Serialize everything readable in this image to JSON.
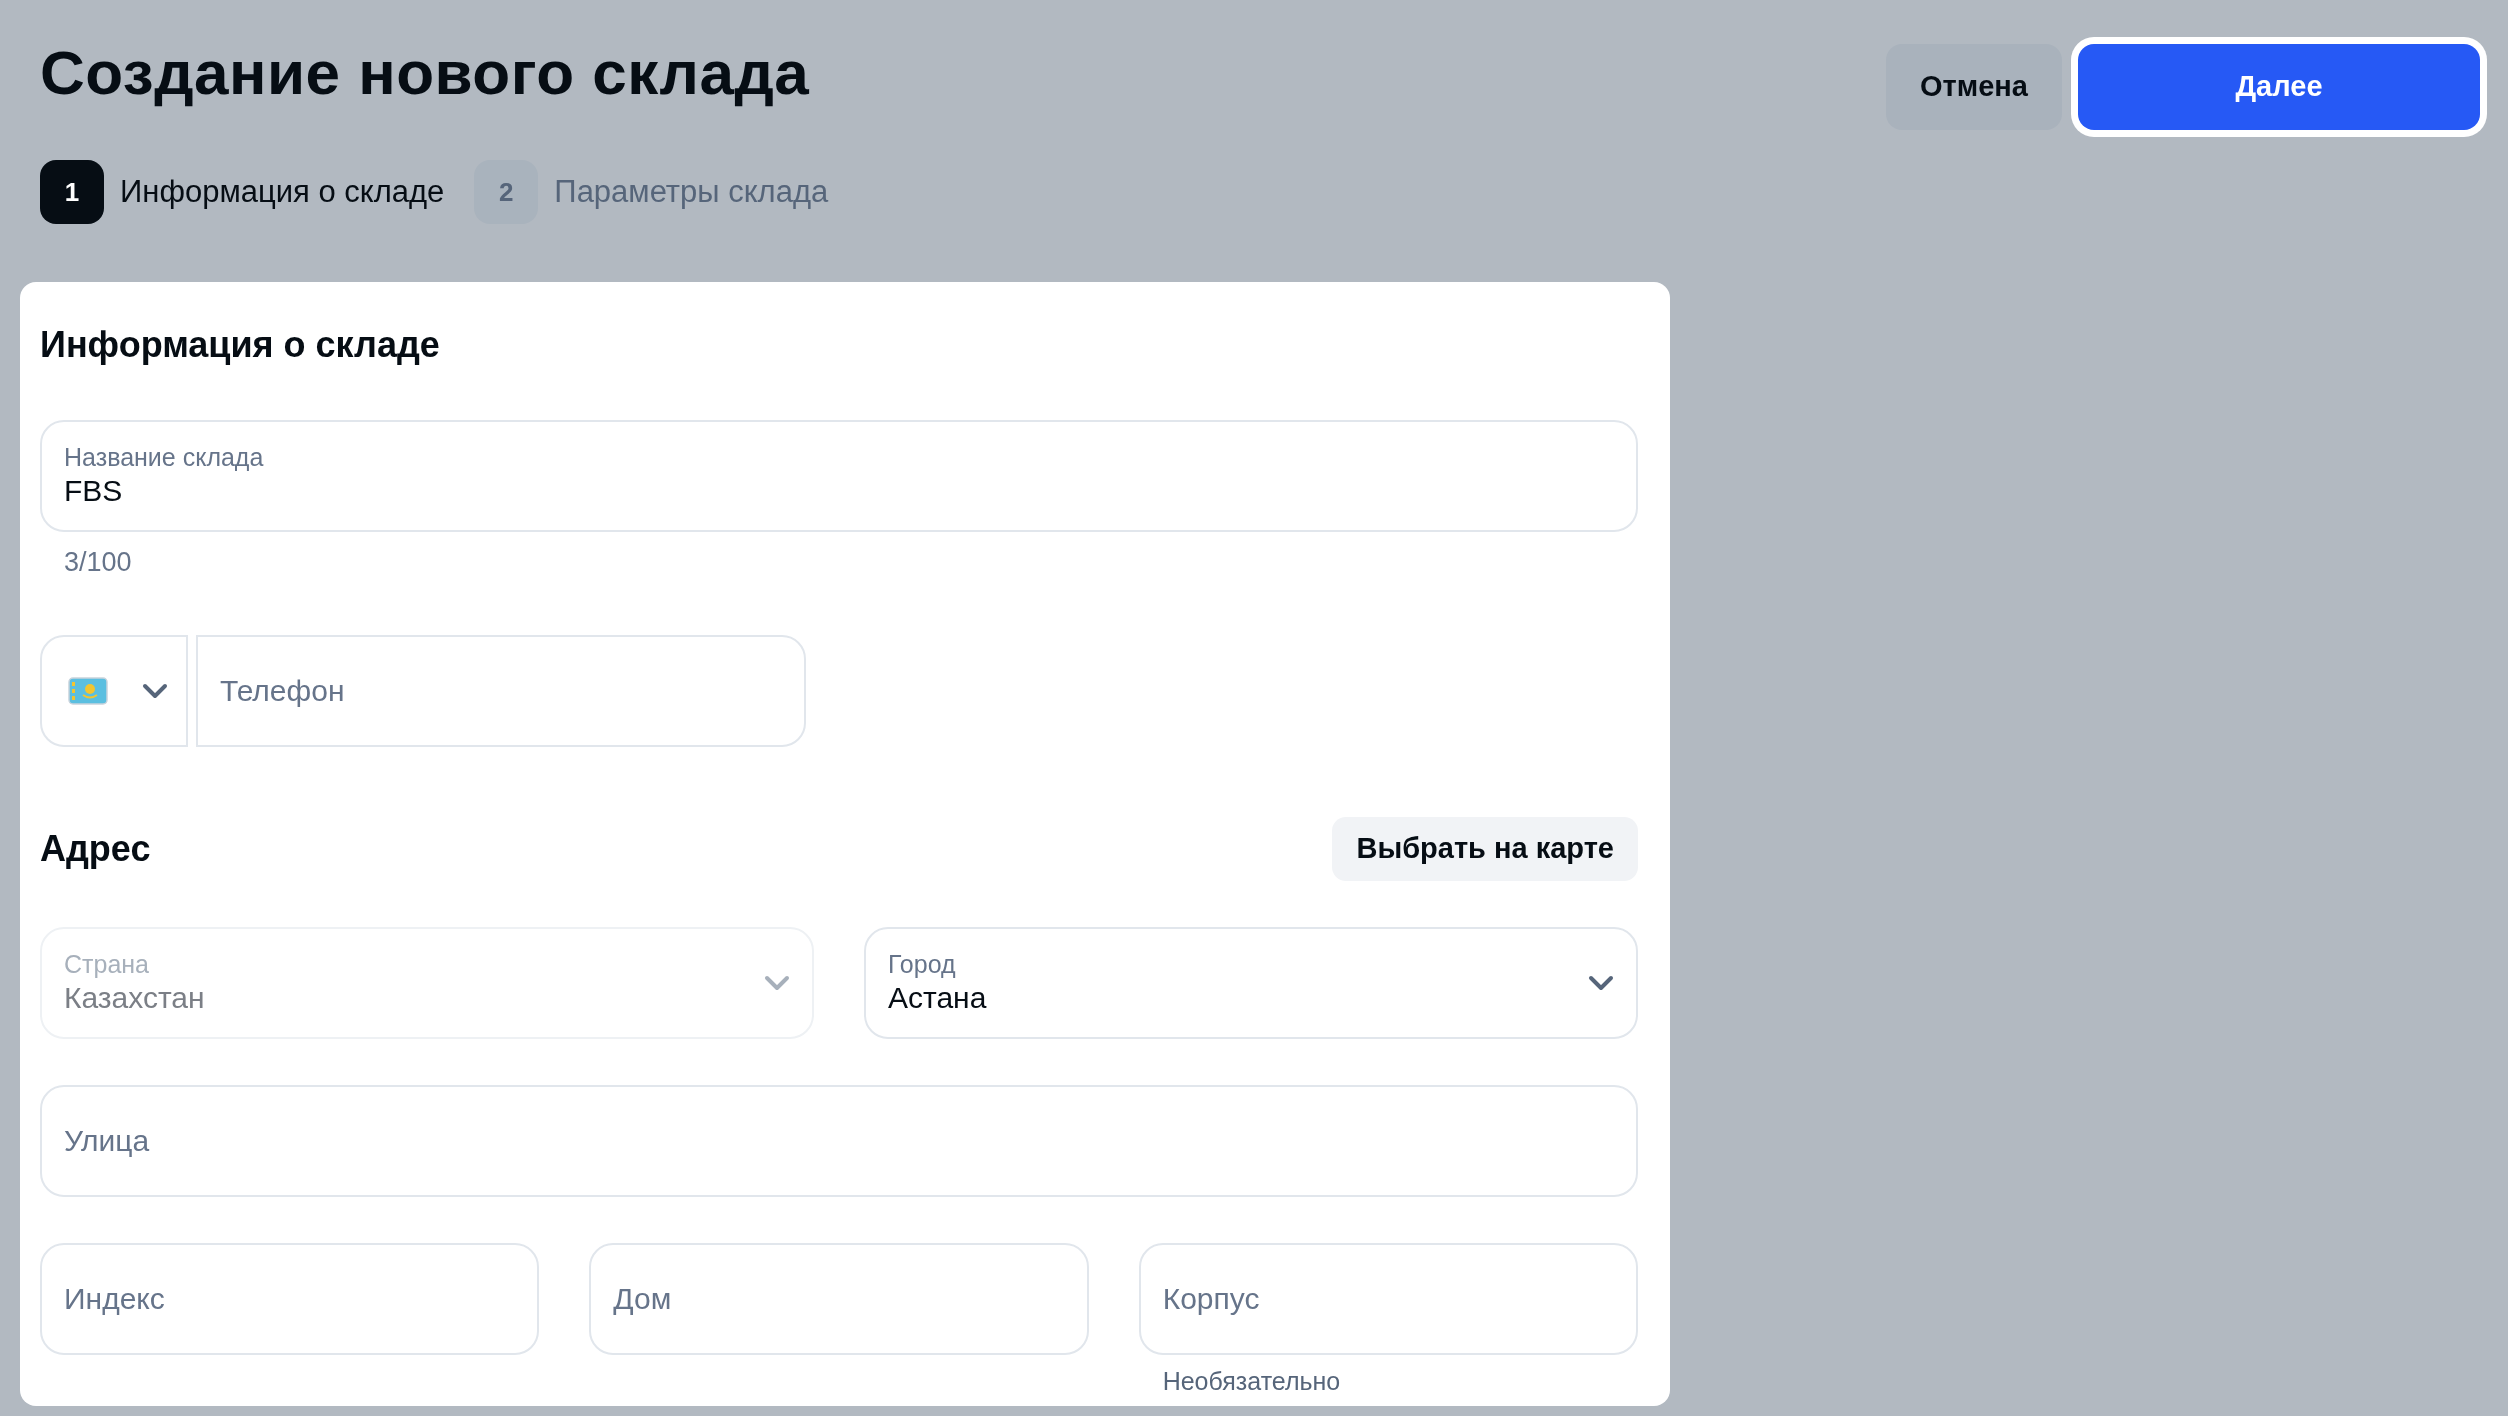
{
  "page": {
    "title": "Создание нового склада"
  },
  "actions": [
    {
      "label": "Отмена",
      "kind": "secondary",
      "focused": false
    },
    {
      "label": "Далее",
      "kind": "primary",
      "focused": true
    }
  ],
  "steps": [
    {
      "number": "1",
      "label": "Информация о складе",
      "selected": true
    },
    {
      "number": "2",
      "label": "Параметры склада",
      "selected": false
    }
  ],
  "card": {
    "title": "Информация о складе",
    "name_field": {
      "label": "Название склада",
      "value": "FBS",
      "counter": "3/100"
    },
    "phone_field": {
      "placeholder": "Телефон"
    },
    "address": {
      "title": "Адрес",
      "map_button": "Выбрать на карте",
      "rows": [
        {
          "fields": [
            {
              "kind": "select",
              "label": "Страна",
              "value": "Казахстан",
              "disabled": true
            },
            {
              "kind": "select",
              "label": "Город",
              "value": "Астана",
              "disabled": false
            }
          ]
        },
        {
          "fields": [
            {
              "kind": "text",
              "placeholder": "Улица",
              "disabled": false
            }
          ]
        },
        {
          "fields": [
            {
              "kind": "text",
              "placeholder": "Индекс",
              "disabled": false
            },
            {
              "kind": "text",
              "placeholder": "Дом",
              "disabled": false
            },
            {
              "kind": "text",
              "placeholder": "Корпус",
              "hint": "Необязательно",
              "disabled": false
            }
          ]
        }
      ]
    }
  }
}
